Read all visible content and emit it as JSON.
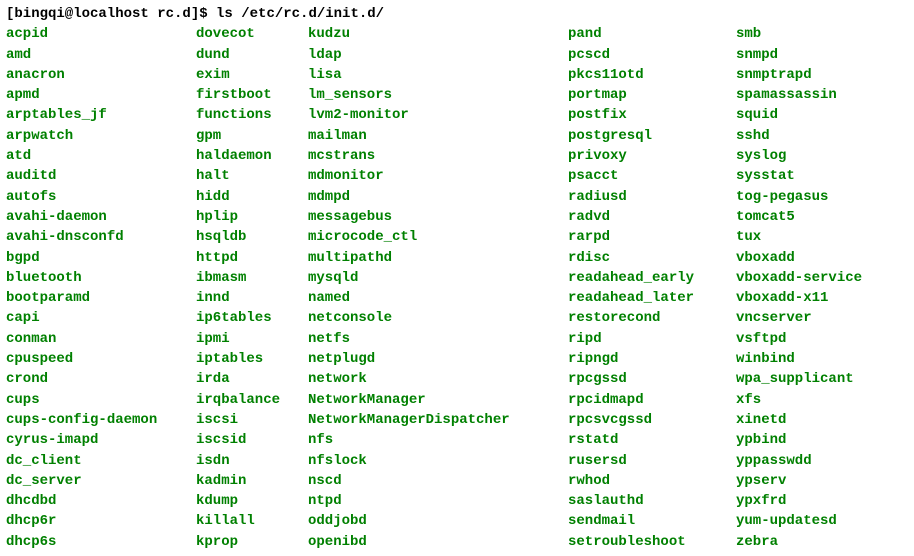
{
  "prompt": "[bingqi@localhost rc.d]$ ls /etc/rc.d/init.d/",
  "columns": {
    "c1": [
      "acpid",
      "amd",
      "anacron",
      "apmd",
      "arptables_jf",
      "arpwatch",
      "atd",
      "auditd",
      "autofs",
      "avahi-daemon",
      "avahi-dnsconfd",
      "bgpd",
      "bluetooth",
      "bootparamd",
      "capi",
      "conman",
      "cpuspeed",
      "crond",
      "cups",
      "cups-config-daemon",
      "cyrus-imapd",
      "dc_client",
      "dc_server",
      "dhcdbd",
      "dhcp6r",
      "dhcp6s"
    ],
    "c2": [
      "dovecot",
      "dund",
      "exim",
      "firstboot",
      "functions",
      "gpm",
      "haldaemon",
      "halt",
      "hidd",
      "hplip",
      "hsqldb",
      "httpd",
      "ibmasm",
      "innd",
      "ip6tables",
      "ipmi",
      "iptables",
      "irda",
      "irqbalance",
      "iscsi",
      "iscsid",
      "isdn",
      "kadmin",
      "kdump",
      "killall",
      "kprop"
    ],
    "c3": [
      "kudzu",
      "ldap",
      "lisa",
      "lm_sensors",
      "lvm2-monitor",
      "mailman",
      "mcstrans",
      "mdmonitor",
      "mdmpd",
      "messagebus",
      "microcode_ctl",
      "multipathd",
      "mysqld",
      "named",
      "netconsole",
      "netfs",
      "netplugd",
      "network",
      "NetworkManager",
      "NetworkManagerDispatcher",
      "nfs",
      "nfslock",
      "nscd",
      "ntpd",
      "oddjobd",
      "openibd"
    ],
    "c4": [
      "pand",
      "pcscd",
      "pkcs11otd",
      "portmap",
      "postfix",
      "postgresql",
      "privoxy",
      "psacct",
      "radiusd",
      "radvd",
      "rarpd",
      "rdisc",
      "readahead_early",
      "readahead_later",
      "restorecond",
      "ripd",
      "ripngd",
      "rpcgssd",
      "rpcidmapd",
      "rpcsvcgssd",
      "rstatd",
      "rusersd",
      "rwhod",
      "saslauthd",
      "sendmail",
      "setroubleshoot"
    ],
    "c5": [
      "smb",
      "snmpd",
      "snmptrapd",
      "spamassassin",
      "squid",
      "sshd",
      "syslog",
      "sysstat",
      "tog-pegasus",
      "tomcat5",
      "tux",
      "vboxadd",
      "vboxadd-service",
      "vboxadd-x11",
      "vncserver",
      "vsftpd",
      "winbind",
      "wpa_supplicant",
      "xfs",
      "xinetd",
      "ypbind",
      "yppasswdd",
      "ypserv",
      "ypxfrd",
      "yum-updatesd",
      "zebra"
    ]
  }
}
